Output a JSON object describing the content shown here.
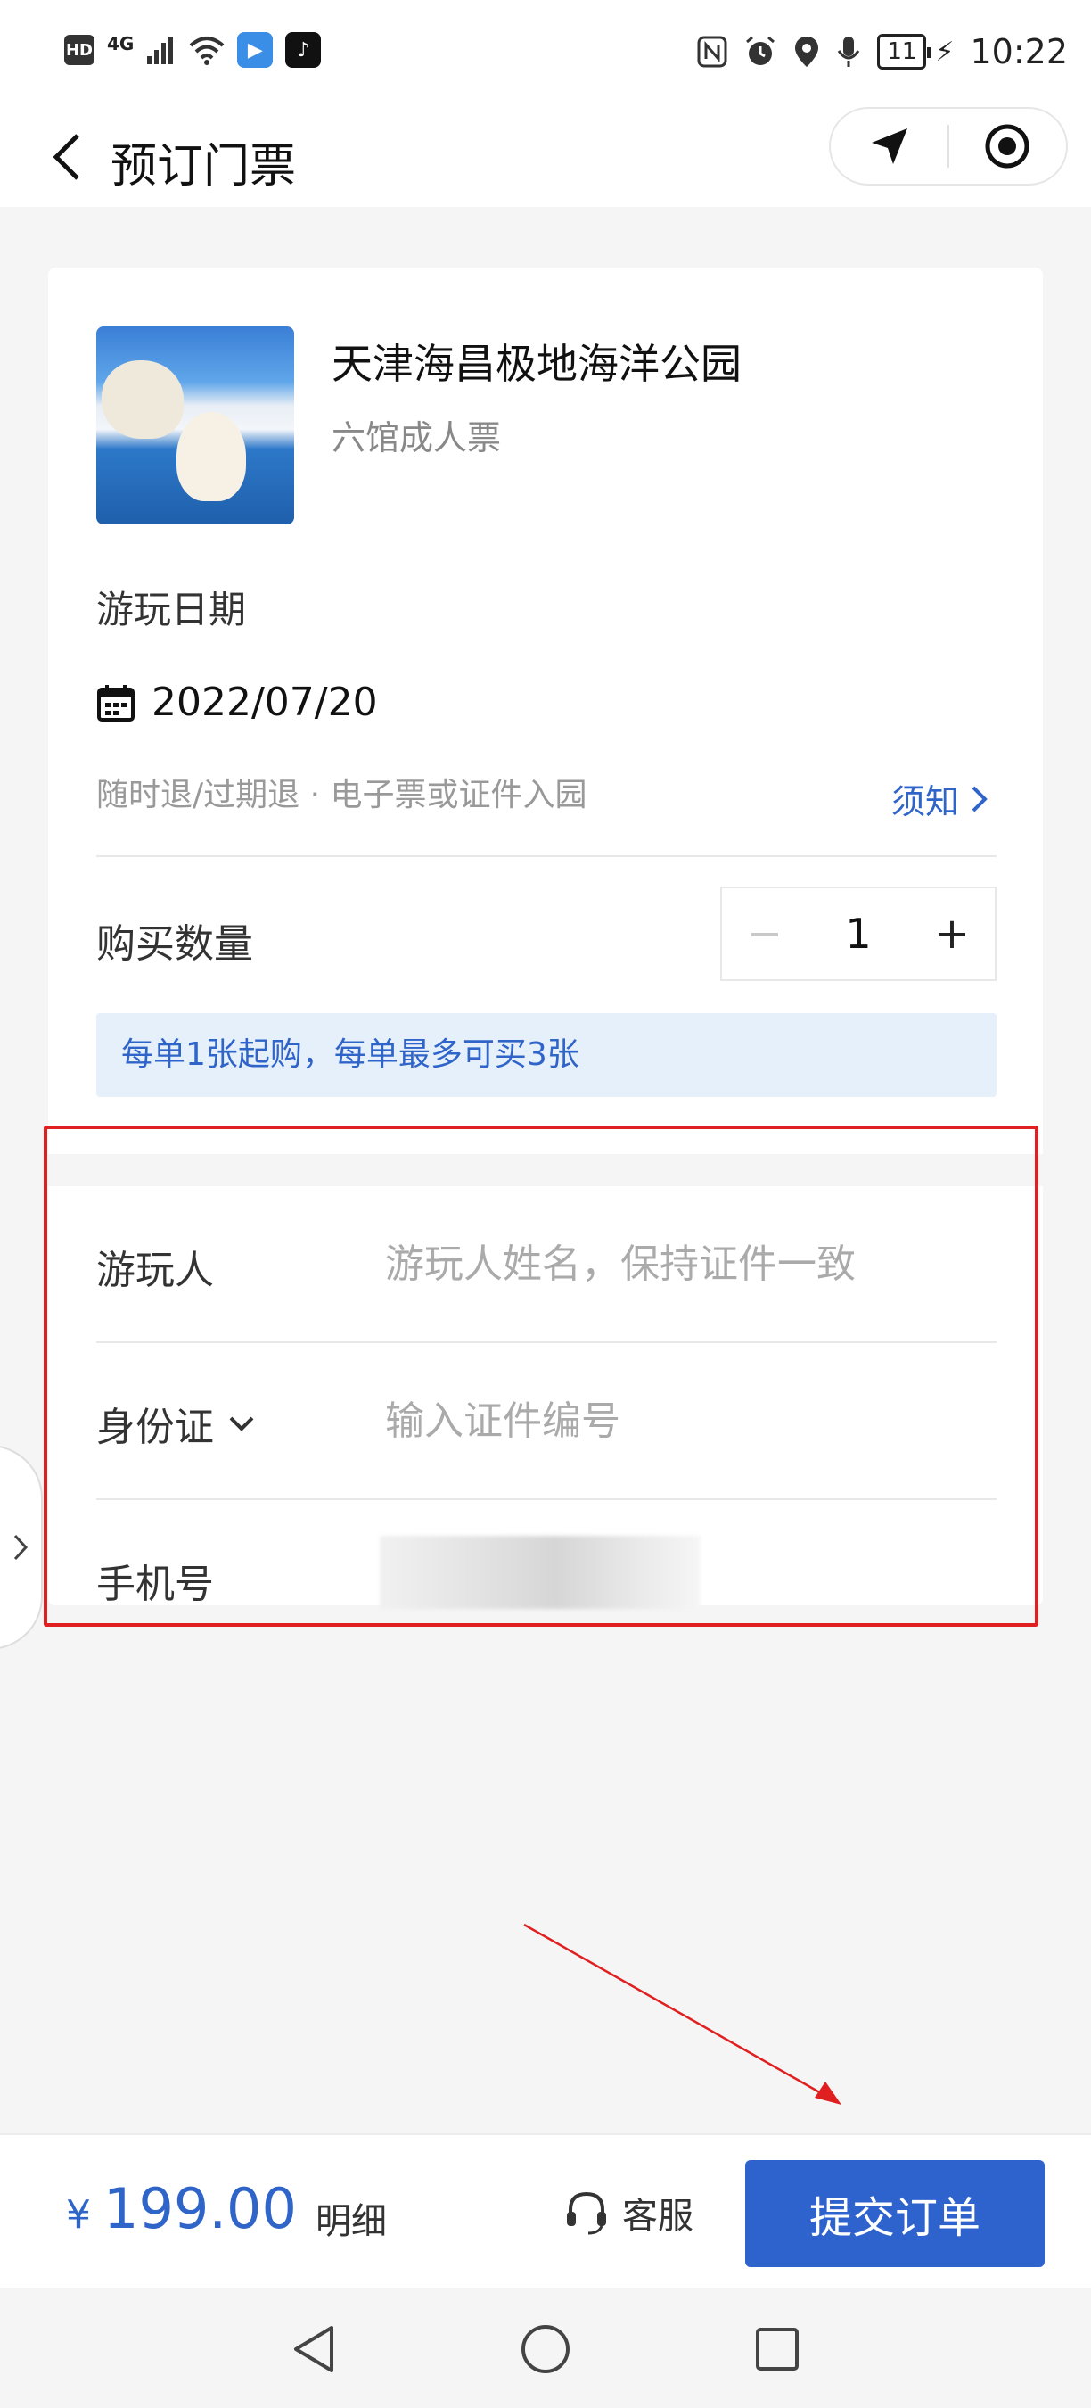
{
  "status_bar": {
    "hd": "HD",
    "network": "4G",
    "battery": "11",
    "time": "10:22"
  },
  "nav": {
    "title": "预订门票"
  },
  "product": {
    "name": "天津海昌极地海洋公园",
    "ticket_type": "六馆成人票"
  },
  "visit": {
    "label": "游玩日期",
    "date": "2022/07/20",
    "policy": "随时退/过期退 · 电子票或证件入园",
    "notice_link": "须知"
  },
  "quantity": {
    "label": "购买数量",
    "minus": "−",
    "value": "1",
    "plus": "+",
    "limit_text": "每单1张起购，每单最多可买3张"
  },
  "form": {
    "visitor_label": "游玩人",
    "visitor_placeholder": "游玩人姓名，保持证件一致",
    "id_type_label": "身份证",
    "id_placeholder": "输入证件编号",
    "phone_label": "手机号"
  },
  "footer": {
    "currency": "¥",
    "price": "199.00",
    "detail_label": "明细",
    "service_label": "客服",
    "submit_label": "提交订单"
  },
  "colors": {
    "accent": "#2e62cc",
    "link": "#2f64c8",
    "annotation": "#e02020",
    "banner_bg": "#e6f0fb"
  },
  "icons": [
    "back-arrow-icon",
    "location-arrow-icon",
    "target-icon",
    "calendar-icon",
    "chevron-right-icon",
    "chevron-down-icon",
    "headset-icon"
  ]
}
